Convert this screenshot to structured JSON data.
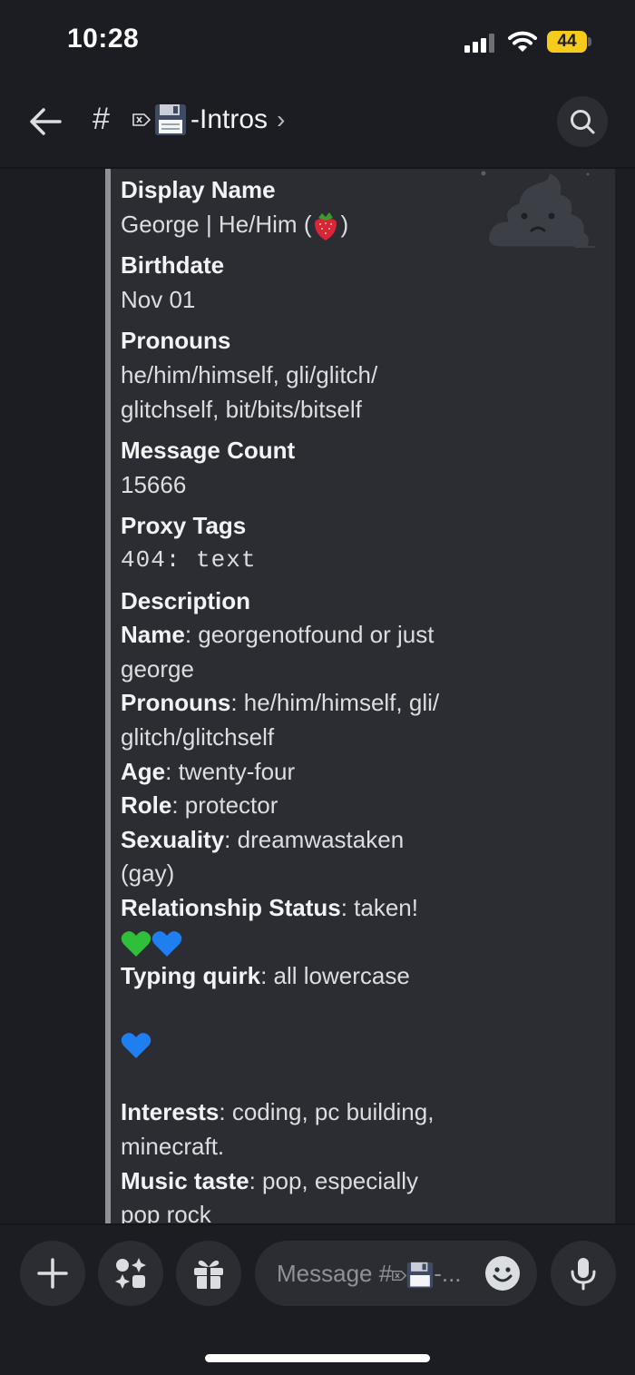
{
  "status_bar": {
    "time": "10:28",
    "battery": "44"
  },
  "header": {
    "hash": "#",
    "channel_name": "-Intros",
    "chevron": "›"
  },
  "embed": {
    "fields": [
      {
        "name": "Display Name",
        "value": "George | He/Him (",
        "value_suffix": ")"
      },
      {
        "name": "Birthdate",
        "value": "Nov 01"
      },
      {
        "name": "Pronouns",
        "value_lines": [
          "he/him/himself, gli/glitch/",
          "glitchself, bit/bits/bitself"
        ]
      },
      {
        "name": "Message Count",
        "value": "15666"
      },
      {
        "name": "Proxy Tags",
        "value": "404: text"
      },
      {
        "name": "Description"
      }
    ],
    "description": {
      "name_label": "Name",
      "name_value_1": ": georgenotfound or just",
      "name_value_2": "george",
      "pronouns_label": "Pronouns",
      "pronouns_value_1": ": he/him/himself, gli/",
      "pronouns_value_2": "glitch/glitchself",
      "age_label": "Age",
      "age_value": ": twenty-four",
      "role_label": "Role",
      "role_value": ": protector",
      "sexuality_label": "Sexuality",
      "sexuality_value_1": ": dreamwastaken",
      "sexuality_value_2": "(gay)",
      "relationship_label": "Relationship Status",
      "relationship_value": ": taken!",
      "typing_label": "Typing quirk",
      "typing_value": ": all lowercase",
      "interests_label": "Interests",
      "interests_value_1": ": coding, pc building,",
      "interests_value_2": "minecraft.",
      "music_label": "Music taste",
      "music_value_1": ": pop, especially",
      "music_value_2": "pop rock"
    }
  },
  "composer": {
    "placeholder": "Message #",
    "placeholder_suffix": "-..."
  },
  "colors": {
    "background": "#1b1d22",
    "embed_bg": "#2b2d33",
    "embed_bar": "#8e9297",
    "battery": "#f5cc1c"
  }
}
